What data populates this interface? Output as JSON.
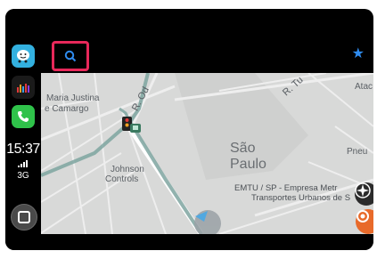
{
  "sidebar": {
    "time": "15:37",
    "network": "3G",
    "apps": [
      "waze-app",
      "podcast-app",
      "phone-app"
    ]
  },
  "topbar": {
    "search_icon": "search-icon",
    "favorite_icon": "star-icon"
  },
  "map": {
    "labels": {
      "maria_justina": "Maria Justina",
      "camargo": "e Camargo",
      "road_od": "R. Od",
      "road_tu": "R. Tu",
      "ata": "Atac",
      "city_line1": "São",
      "city_line2": "Paulo",
      "pneu": "Pneu",
      "johnson1": "Johnson",
      "johnson2": "Controls",
      "emtu1": "EMTU / SP - Empresa Metr",
      "emtu2": "Transportes Urbanos de S"
    }
  },
  "colors": {
    "search_highlight": "#e8285a",
    "star": "#2f8cf0",
    "report": "#e86a2a",
    "map_bg": "#d8d9d8"
  }
}
